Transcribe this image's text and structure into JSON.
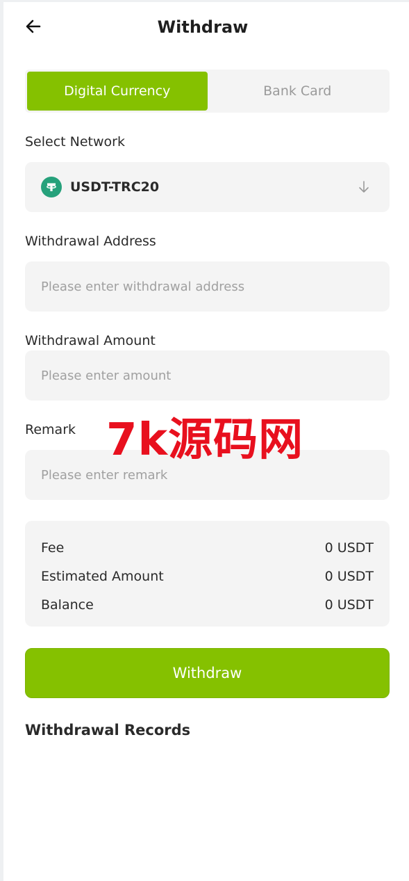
{
  "header": {
    "title": "Withdraw"
  },
  "tabs": [
    {
      "label": "Digital Currency",
      "active": true
    },
    {
      "label": "Bank Card",
      "active": false
    }
  ],
  "network": {
    "label": "Select Network",
    "value": "USDT-TRC20",
    "icon": "tether-icon"
  },
  "address": {
    "label": "Withdrawal Address",
    "value": "",
    "placeholder": "Please enter withdrawal address"
  },
  "amount": {
    "label": "Withdrawal Amount",
    "value": "",
    "placeholder": "Please enter amount"
  },
  "remark": {
    "label": "Remark",
    "value": "",
    "placeholder": "Please enter remark"
  },
  "summary": {
    "rows": [
      {
        "label": "Fee",
        "value": "0 USDT"
      },
      {
        "label": "Estimated Amount",
        "value": "0 USDT"
      },
      {
        "label": "Balance",
        "value": "0 USDT"
      }
    ]
  },
  "submit_label": "Withdraw",
  "records_title": "Withdrawal Records",
  "watermark": "7k源码网",
  "colors": {
    "accent": "#85c100",
    "tether": "#26a17b",
    "field_bg": "#f4f4f4",
    "watermark": "#e8101e"
  }
}
